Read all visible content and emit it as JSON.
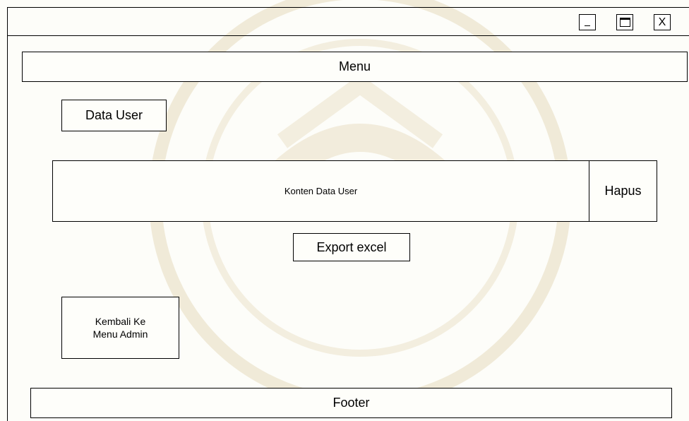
{
  "window": {
    "minimize_label": "_",
    "close_label": "X"
  },
  "menu": {
    "label": "Menu"
  },
  "section": {
    "title": "Data User"
  },
  "content": {
    "label": "Konten Data User",
    "delete_label": "Hapus"
  },
  "actions": {
    "export_label": "Export excel",
    "back_label_line1": "Kembali Ke",
    "back_label_line2": "Menu Admin"
  },
  "footer": {
    "label": "Footer"
  }
}
